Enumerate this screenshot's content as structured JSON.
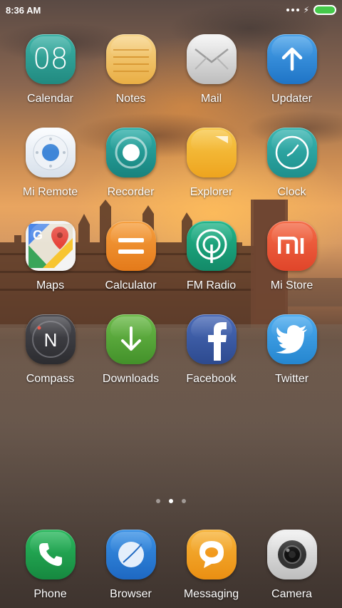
{
  "status_bar": {
    "time": "8:36 AM"
  },
  "pager": {
    "page_count": 3,
    "active_index": 1
  },
  "apps": [
    {
      "label": "Calendar",
      "icon": "calendar-icon",
      "color": "#2e9e93",
      "text": "08"
    },
    {
      "label": "Notes",
      "icon": "notes-icon",
      "color": "#f2c26a"
    },
    {
      "label": "Mail",
      "icon": "mail-icon",
      "color": "#dcdcdc"
    },
    {
      "label": "Updater",
      "icon": "updater-icon",
      "color": "#2e8ad6"
    },
    {
      "label": "Mi Remote",
      "icon": "mi-remote-icon",
      "color": "#e9eef5"
    },
    {
      "label": "Recorder",
      "icon": "recorder-icon",
      "color": "#1f9a95"
    },
    {
      "label": "Explorer",
      "icon": "explorer-icon",
      "color": "#f3b52b"
    },
    {
      "label": "Clock",
      "icon": "clock-icon",
      "color": "#2aa6a3"
    },
    {
      "label": "Maps",
      "icon": "maps-icon",
      "color": "#f2f2f2"
    },
    {
      "label": "Calculator",
      "icon": "calculator-icon",
      "color": "#f08c2a"
    },
    {
      "label": "FM Radio",
      "icon": "fm-radio-icon",
      "color": "#1aa77e"
    },
    {
      "label": "Mi Store",
      "icon": "mi-store-icon",
      "color": "#ef5a3a"
    },
    {
      "label": "Compass",
      "icon": "compass-icon",
      "color": "#3e3e42"
    },
    {
      "label": "Downloads",
      "icon": "downloads-icon",
      "color": "#5aa83a"
    },
    {
      "label": "Facebook",
      "icon": "facebook-icon",
      "color": "#3b5aa3"
    },
    {
      "label": "Twitter",
      "icon": "twitter-icon",
      "color": "#3a9be0"
    }
  ],
  "dock": [
    {
      "label": "Phone",
      "icon": "phone-icon",
      "color": "#1fa650"
    },
    {
      "label": "Browser",
      "icon": "browser-icon",
      "color": "#2a7fd8"
    },
    {
      "label": "Messaging",
      "icon": "messaging-icon",
      "color": "#f2a21e"
    },
    {
      "label": "Camera",
      "icon": "camera-icon",
      "color": "#d9d9d9"
    }
  ]
}
